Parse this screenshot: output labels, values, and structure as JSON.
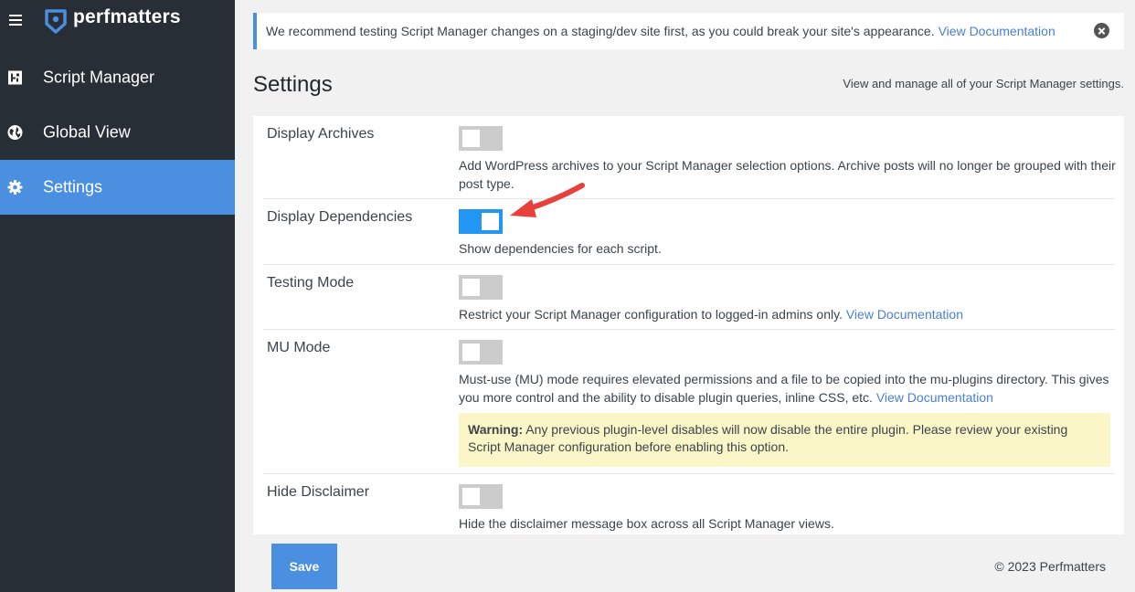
{
  "brand": {
    "name": "perfmatters"
  },
  "sidebar": {
    "items": [
      {
        "label": "Script Manager",
        "icon": "script-manager-icon"
      },
      {
        "label": "Global View",
        "icon": "globe-icon"
      },
      {
        "label": "Settings",
        "icon": "gear-icon",
        "active": true
      }
    ]
  },
  "notice": {
    "text": "We recommend testing Script Manager changes on a staging/dev site first, as you could break your site's appearance.",
    "link": "View Documentation"
  },
  "page": {
    "title": "Settings",
    "description": "View and manage all of your Script Manager settings."
  },
  "settings": [
    {
      "label": "Display Archives",
      "enabled": false,
      "description": "Add WordPress archives to your Script Manager selection options. Archive posts will no longer be grouped with their post type."
    },
    {
      "label": "Display Dependencies",
      "enabled": true,
      "description": "Show dependencies for each script."
    },
    {
      "label": "Testing Mode",
      "enabled": false,
      "description": "Restrict your Script Manager configuration to logged-in admins only.",
      "link": "View Documentation"
    },
    {
      "label": "MU Mode",
      "enabled": false,
      "description": "Must-use (MU) mode requires elevated permissions and a file to be copied into the mu-plugins directory. This gives you more control and the ability to disable plugin queries, inline CSS, etc.",
      "link": "View Documentation",
      "warning": {
        "title": "Warning:",
        "text": "Any previous plugin-level disables will now disable the entire plugin. Please review your existing Script Manager configuration before enabling this option."
      }
    },
    {
      "label": "Hide Disclaimer",
      "enabled": false,
      "description": "Hide the disclaimer message box across all Script Manager views."
    }
  ],
  "footer": {
    "save_label": "Save",
    "copyright": "© 2023 Perfmatters"
  },
  "colors": {
    "accent": "#4a8fe0",
    "sidebar": "#282e35",
    "toggle_on": "#2196f3",
    "annotation_arrow": "#e8403c"
  }
}
